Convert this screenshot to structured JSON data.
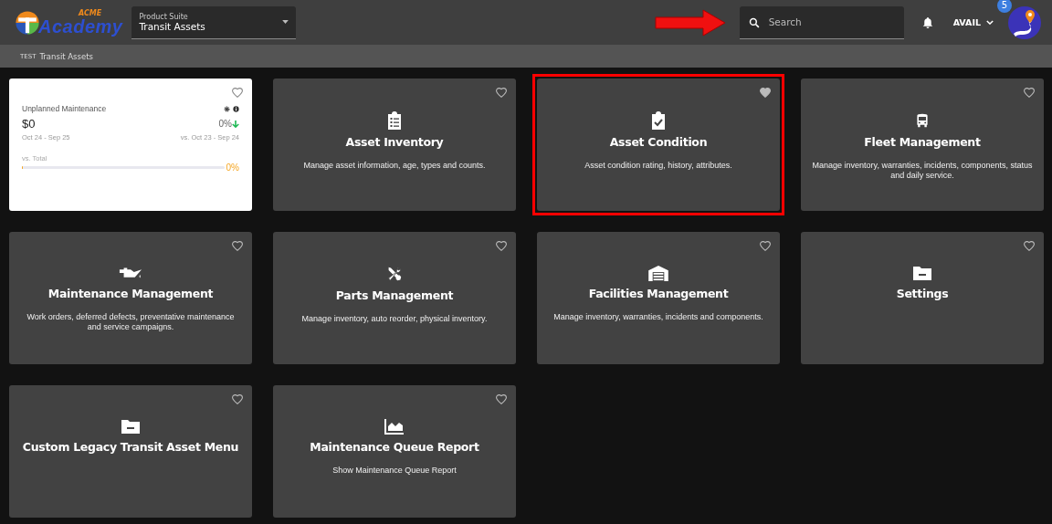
{
  "header": {
    "logo": {
      "top": "ACME",
      "bottom": "Academy"
    },
    "product_suite": {
      "label": "Product Suite",
      "value": "Transit Assets"
    },
    "search": {
      "placeholder": "Search"
    },
    "annotation_arrow": true,
    "user": "AVAIL",
    "badge": "5"
  },
  "breadcrumb": [
    "TEST",
    "Transit Assets"
  ],
  "kpi_card": {
    "title": "Unplanned Maintenance",
    "value": "$0",
    "change": "0%",
    "period": "Oct 24 - Sep 25",
    "comparison": "vs. Oct 23 - Sep 24",
    "bar_label": "vs. Total",
    "level": 0,
    "reading": "0%",
    "favorite": false
  },
  "tiles": [
    {
      "kind": "clipboard-list",
      "title": "Asset Inventory",
      "description": "Manage asset information, age, types and counts.",
      "favorite": false,
      "highlighted": false
    },
    {
      "kind": "clipboard-check",
      "title": "Asset Condition",
      "description": "Asset condition rating, history, attributes.",
      "favorite": true,
      "highlighted": true
    },
    {
      "kind": "bus",
      "title": "Fleet Management",
      "description": "Manage inventory, warranties, incidents, components, status and daily service.",
      "favorite": false,
      "highlighted": false
    },
    {
      "kind": "oil-can",
      "title": "Maintenance Management",
      "description": "Work orders, deferred defects, preventative maintenance and service campaigns.",
      "favorite": false,
      "highlighted": false
    },
    {
      "kind": "tools",
      "title": "Parts Management",
      "description": "Manage inventory, auto reorder, physical inventory.",
      "favorite": false,
      "highlighted": false
    },
    {
      "kind": "warehouse",
      "title": "Facilities Management",
      "description": "Manage inventory, warranties, incidents and components.",
      "favorite": false,
      "highlighted": false
    },
    {
      "kind": "folder",
      "title": "Settings",
      "favorite": false,
      "highlighted": false
    },
    {
      "kind": "folder",
      "title": "Custom Legacy Transit Asset Menu",
      "favorite": false,
      "highlighted": false
    },
    {
      "kind": "chart",
      "title": "Maintenance Queue Report",
      "description": "Show Maintenance Queue Report",
      "favorite": false,
      "highlighted": false
    }
  ]
}
